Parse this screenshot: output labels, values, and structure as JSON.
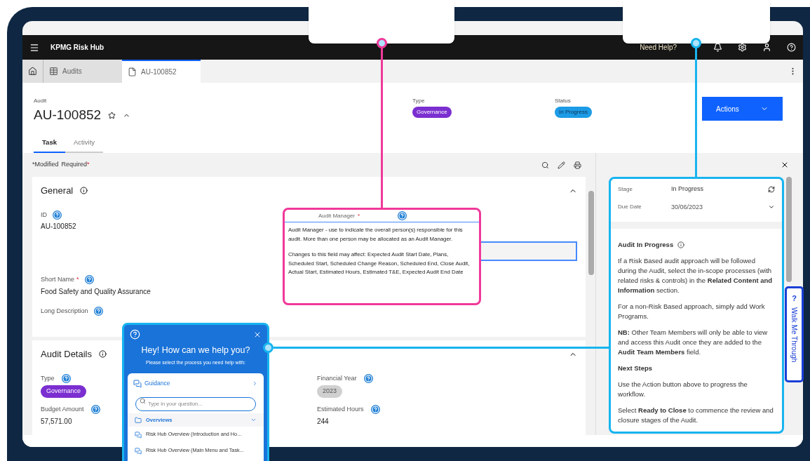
{
  "header": {
    "title": "KPMG Risk Hub",
    "help_link": "Need Help?"
  },
  "nav_tabs": [
    {
      "label": "Audits",
      "kind": "list",
      "selected": false
    },
    {
      "label": "AU-100852",
      "kind": "record",
      "selected": true
    }
  ],
  "record": {
    "label": "Audit",
    "id": "AU-100852",
    "type_label": "Type",
    "type": "Governance",
    "status_label": "Status",
    "status": "In Progress",
    "actions": "Actions"
  },
  "tabs": [
    {
      "label": "Task",
      "selected": true
    },
    {
      "label": "Activity",
      "selected": false
    }
  ],
  "legend": {
    "modified": "*Modified",
    "required": "Required",
    "required_mark": "*"
  },
  "general": {
    "title": "General",
    "expanded": true,
    "fields": [
      {
        "label": "ID",
        "required": false,
        "value": "AU-100852"
      },
      {
        "label": "Short Name",
        "required": true,
        "value": "Food Safety and Quality Assurance"
      },
      {
        "label": "Long Description",
        "required": false
      }
    ]
  },
  "field_tooltip": {
    "label": "Audit Manager",
    "required": true,
    "paragraphs": [
      "Audit Manager - use to indicate the overall person(s) responsible for this audit. More than one person may be allocated as an Audit Manager.",
      "Changes to this field may affect: Expected Audit Start Date, Plans, Scheduled Start, Scheduled Change Reason, Scheduled End, Close Audit, Actual Start, Estimated Hours, Estimated T&E, Expected Audit End Date"
    ]
  },
  "audit_details": {
    "title": "Audit Details",
    "expanded": true,
    "fields": [
      {
        "label": "Type",
        "kind": "badge",
        "value": "Governance",
        "color": "#7b2fd0"
      },
      {
        "label": "Financial Year",
        "kind": "badge",
        "value": "2023",
        "color": "#d0d0d0"
      },
      {
        "label": "Budget Amount",
        "kind": "text",
        "value": "57,571.00"
      },
      {
        "label": "Estimated Hours",
        "kind": "text",
        "value": "244"
      }
    ]
  },
  "stage": {
    "stage_label": "Stage",
    "stage": "In Progress",
    "due_label": "Due Date",
    "due": "30/06/2023"
  },
  "guidance": {
    "title": "Audit In Progress",
    "blocks": [
      {
        "kind": "paragraph",
        "text": "If a Risk Based audit approach will be followed during the Audit, select the in-scope processes (with related risks & controls) in the **Related Content and Information** section."
      },
      {
        "kind": "paragraph",
        "text": "For a non-Risk Based approach, simply add Work Programs."
      },
      {
        "kind": "paragraph",
        "text": "**NB:** Other Team Members will only be able to view and access this Audit once they are added to the **Audit Team Members** field."
      },
      {
        "kind": "heading",
        "text": "Next Steps"
      },
      {
        "kind": "paragraph",
        "text": "Use the Action button above to progress the workflow."
      },
      {
        "kind": "paragraph",
        "text": "Select **Ready to Close** to commence the review and closure stages of the Audit."
      }
    ]
  },
  "walk_me": {
    "mark": "?",
    "label": "Walk Me Through"
  },
  "chat": {
    "title": "Hey! How can we help you?",
    "subtitle": "Please select the process you need help with:",
    "guidance": "Guidance",
    "search_placeholder": "Type in your question...",
    "category": {
      "label": "Overviews",
      "expanded": true
    },
    "items": [
      "Risk Hub Overview (Introduction and Ho...",
      "Risk Hub Overview (Main Menu and Task..."
    ]
  }
}
